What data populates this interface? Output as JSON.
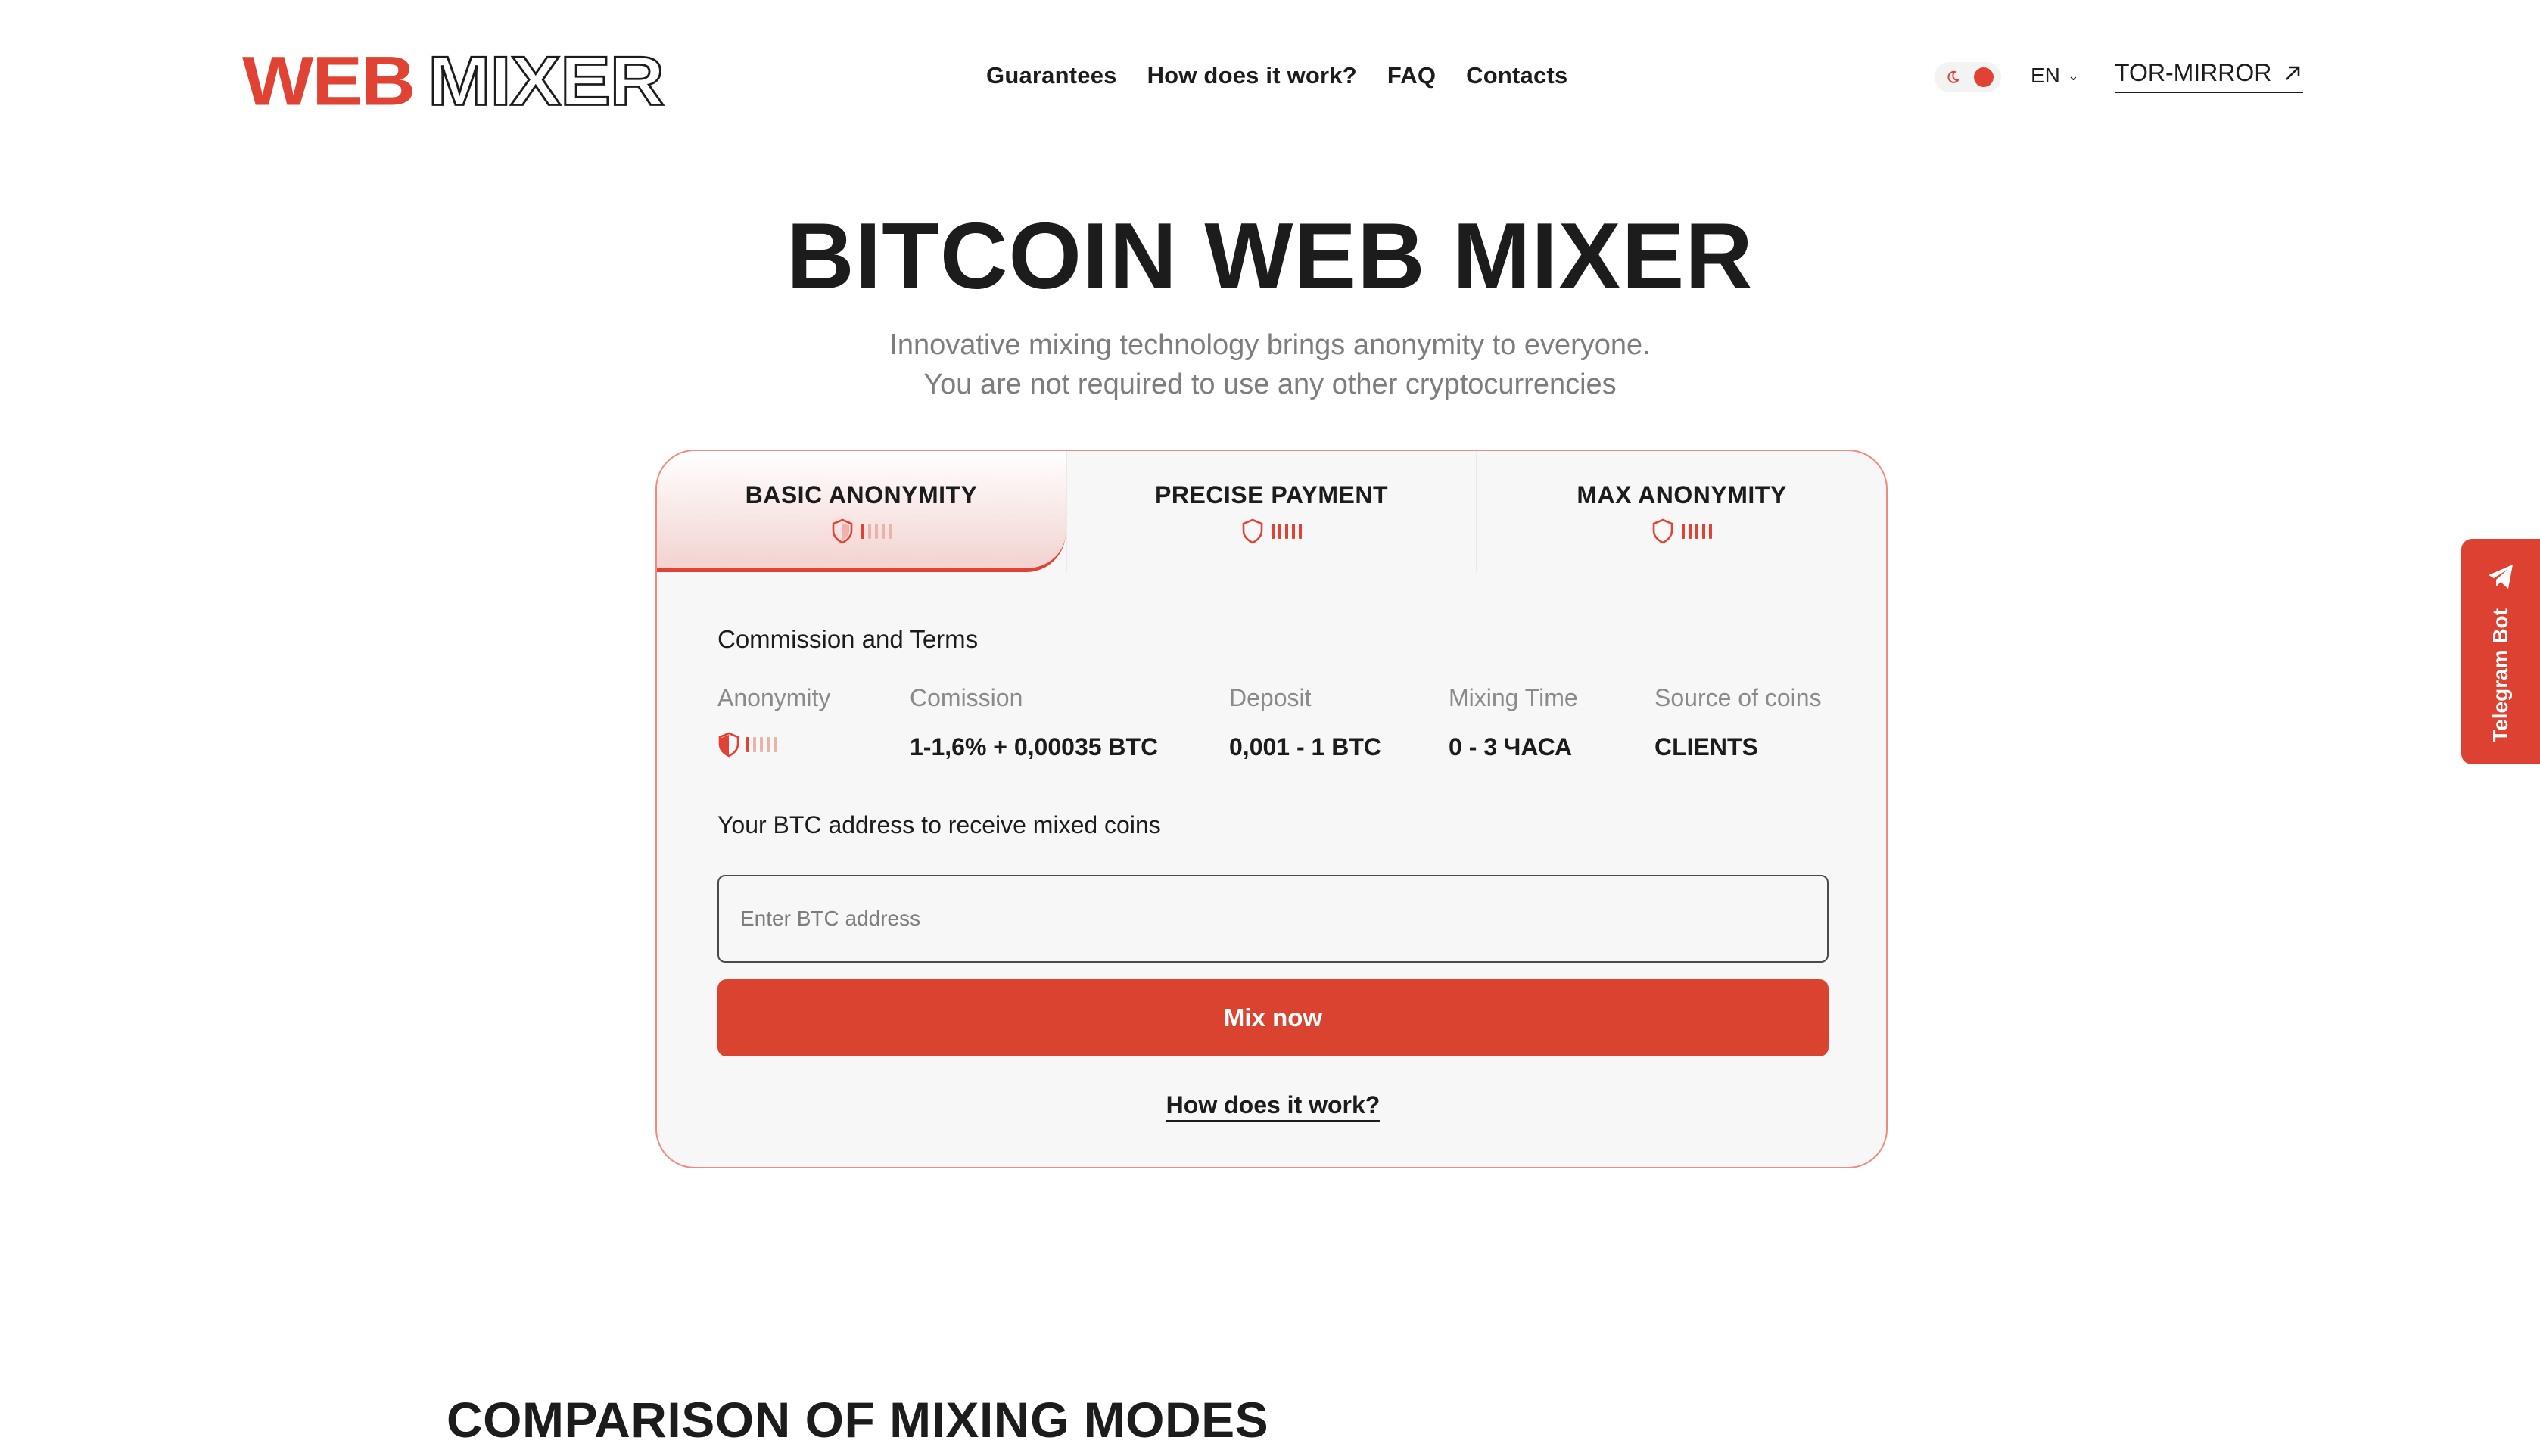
{
  "brand": {
    "logo_part1": "WEB",
    "logo_part2": "MIXER",
    "accent_color": "#e04334"
  },
  "nav": {
    "items": [
      "Guarantees",
      "How does it work?",
      "FAQ",
      "Contacts"
    ]
  },
  "header": {
    "language": "EN",
    "tor_mirror": "TOR-MIRROR"
  },
  "hero": {
    "title": "BITCOIN WEB MIXER",
    "subtitle_line1": "Innovative mixing technology brings anonymity to everyone.",
    "subtitle_line2": "You are not required to use any other cryptocurrencies"
  },
  "modes": {
    "tabs": [
      {
        "label": "BASIC ANONYMITY",
        "level": 1,
        "max": 5,
        "active": true
      },
      {
        "label": "PRECISE PAYMENT",
        "level": 5,
        "max": 5,
        "active": false
      },
      {
        "label": "MAX ANONYMITY",
        "level": 5,
        "max": 5,
        "active": false
      }
    ]
  },
  "terms": {
    "title": "Commission and Terms",
    "columns": {
      "anonymity": {
        "header": "Anonymity",
        "level": 1,
        "max": 5
      },
      "commission": {
        "header": "Comission",
        "value": "1-1,6% + 0,00035 BTC"
      },
      "deposit": {
        "header": "Deposit",
        "value": "0,001 - 1 BTC"
      },
      "mixing_time": {
        "header": "Mixing Time",
        "value": "0 - 3 ЧАСА"
      },
      "source": {
        "header": "Source of coins",
        "value": "CLIENTS"
      }
    }
  },
  "form": {
    "address_label": "Your BTC address to receive mixed coins",
    "address_placeholder": "Enter BTC address",
    "address_value": "",
    "submit_label": "Mix now",
    "how_link": "How does it work?"
  },
  "telegram": {
    "label": "Telegram Bot",
    "icon": "telegram-icon"
  },
  "comparison": {
    "title": "COMPARISON OF MIXING MODES"
  }
}
